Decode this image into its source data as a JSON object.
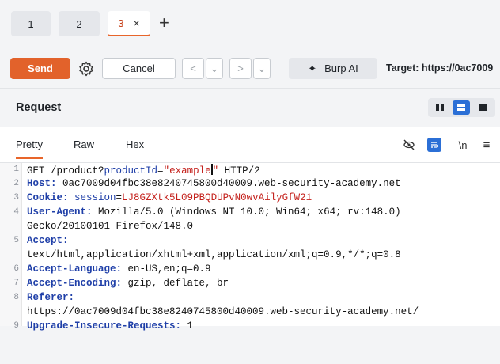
{
  "tabs": [
    {
      "label": "1"
    },
    {
      "label": "2"
    },
    {
      "label": "3",
      "active": true
    }
  ],
  "toolbar": {
    "send_label": "Send",
    "cancel_label": "Cancel",
    "burp_ai_label": "Burp AI",
    "target_label": "Target: https://0ac7009"
  },
  "request": {
    "title": "Request",
    "subtabs": {
      "pretty": "Pretty",
      "raw": "Raw",
      "hex": "Hex"
    },
    "newline_toggle": "\\n",
    "lines": [
      {
        "num": "1",
        "method_path": "GET /product?",
        "param_name": "productId",
        "eq": "=",
        "param_value": "\"example",
        "param_value_end": "\"",
        "rest": " HTTP/2"
      },
      {
        "num": "2",
        "name": "Host:",
        "value": " 0ac7009d04fbc38e8240745800d40009.web-security-academy.net"
      },
      {
        "num": "3",
        "name": "Cookie:",
        "cookie_name": " session",
        "cookie_eq": "=",
        "cookie_value": "LJ8GZXtk5L09PBQDUPvN0wvAilyGfW21"
      },
      {
        "num": "4",
        "name": "User-Agent:",
        "value": " Mozilla/5.0 (Windows NT 10.0; Win64; x64; rv:148.0)"
      },
      {
        "num": "",
        "value": "Gecko/20100101 Firefox/148.0"
      },
      {
        "num": "5",
        "name": "Accept:",
        "value": ""
      },
      {
        "num": "",
        "value": "text/html,application/xhtml+xml,application/xml;q=0.9,*/*;q=0.8"
      },
      {
        "num": "6",
        "name": "Accept-Language:",
        "value": " en-US,en;q=0.9"
      },
      {
        "num": "7",
        "name": "Accept-Encoding:",
        "value": " gzip, deflate, br"
      },
      {
        "num": "8",
        "name": "Referer:",
        "value": ""
      },
      {
        "num": "",
        "value": "https://0ac7009d04fbc38e8240745800d40009.web-security-academy.net/"
      },
      {
        "num": "9",
        "name": "Upgrade-Insecure-Requests:",
        "value": " 1"
      }
    ]
  },
  "colors": {
    "accent_orange": "#e2622b",
    "header_blue": "#1f3fa8",
    "value_red": "#c4211c",
    "view_active_blue": "#2b6fd6"
  }
}
